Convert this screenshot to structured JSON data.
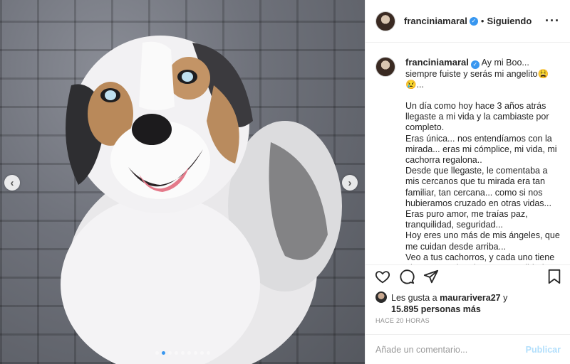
{
  "post": {
    "username": "franciniamaral",
    "follow_status": "Siguiendo",
    "separator": "•",
    "more_icon": "more-options-icon"
  },
  "caption": {
    "username": "franciniamaral",
    "intro": " Ay mi Boo... siempre fuiste y serás mi angelito😩😢...",
    "body": "Un día como hoy hace 3 años atrás llegaste a mi vida y la cambiaste por completo.\nEras única... nos entendíamos con la mirada... eras mi cómplice, mi vida, mi cachorra regalona..\nDesde que llegaste, le comentaba a mis cercanos que tu mirada era tan familiar, tan cercana... como si nos hubieramos cruzado en otras vidas...\nEras puro amor, me traías paz, tranquilidad, seguridad...\nHoy eres uno más de mis ángeles, que me cuidan desde arriba...\nVeo a tus cachorros, y cada uno tiene algo tuyo... algo de tu personalidad"
  },
  "likes": {
    "prefix": "Les gusta a",
    "user": "maurarivera27",
    "joiner": "y",
    "count": "15.895 personas más"
  },
  "timestamp": "HACE 20 HORAS",
  "comment": {
    "placeholder": "Añade un comentario...",
    "publish_label": "Publicar"
  },
  "carousel": {
    "total_slides": 9,
    "active_index": 1,
    "prev_label": "‹",
    "next_label": "›"
  },
  "colors": {
    "accent": "#3897f0",
    "publish_disabled": "#b2dffc"
  }
}
